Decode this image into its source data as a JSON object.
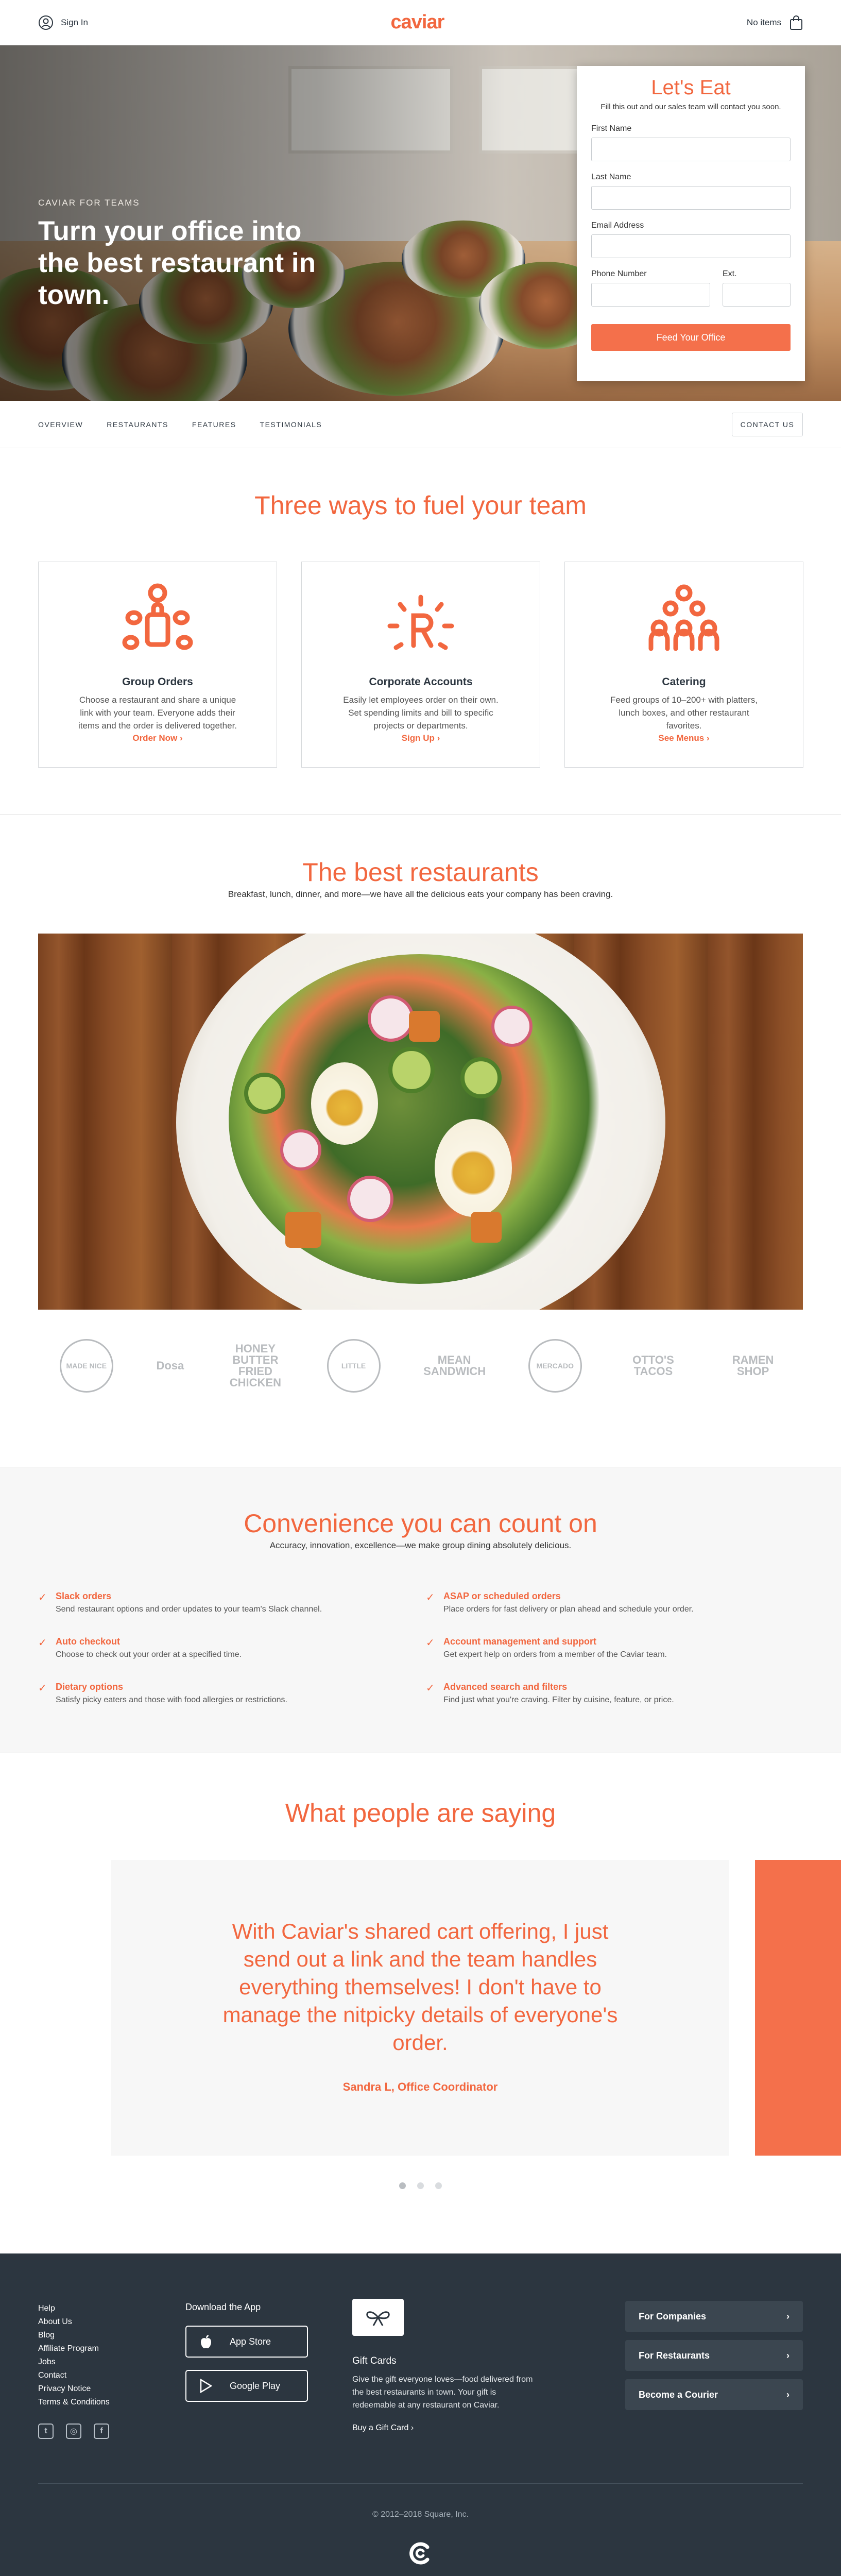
{
  "header": {
    "signin_label": "Sign In",
    "logo": "caviar",
    "cart_label": "No items"
  },
  "hero": {
    "tag": "CAVIAR FOR TEAMS",
    "title": "Turn your office into the best restaurant in town."
  },
  "form": {
    "title": "Let's Eat",
    "subtitle": "Fill this out and our sales team will contact you soon.",
    "first_name_label": "First Name",
    "last_name_label": "Last Name",
    "email_label": "Email Address",
    "phone_label": "Phone Number",
    "ext_label": "Ext.",
    "submit_label": "Feed Your Office"
  },
  "subnav": {
    "links": [
      "OVERVIEW",
      "RESTAURANTS",
      "FEATURES",
      "TESTIMONIALS"
    ],
    "contact_label": "CONTACT US"
  },
  "three_ways": {
    "title": "Three ways to fuel your team",
    "cards": [
      {
        "title": "Group Orders",
        "desc": "Choose a restaurant and share a unique link with your team. Everyone adds their items and the order is delivered together.",
        "cta": "Order Now ›"
      },
      {
        "title": "Corporate Accounts",
        "desc": "Easily let employees order on their own. Set spending limits and bill to specific projects or departments.",
        "cta": "Sign Up ›"
      },
      {
        "title": "Catering",
        "desc": "Feed groups of 10–200+ with platters, lunch boxes, and other restaurant favorites.",
        "cta": "See Menus ›"
      }
    ]
  },
  "best": {
    "title": "The best restaurants",
    "subtitle": "Breakfast, lunch, dinner, and more—we have all the delicious eats your company has been craving.",
    "logos": [
      "MADE NICE",
      "Dosa",
      "HONEY BUTTER FRIED CHICKEN",
      "LITTLE",
      "MEAN SANDWICH",
      "MERCADO",
      "OTTO'S TACOS",
      "RAMEN SHOP"
    ]
  },
  "convenience": {
    "title": "Convenience you can count on",
    "subtitle": "Accuracy, innovation, excellence—we make group dining absolutely delicious.",
    "features": [
      {
        "title": "Slack orders",
        "desc": "Send restaurant options and order updates to your team's Slack channel."
      },
      {
        "title": "ASAP or scheduled orders",
        "desc": "Place orders for fast delivery or plan ahead and schedule your order."
      },
      {
        "title": "Auto checkout",
        "desc": "Choose to check out your order at a specified time."
      },
      {
        "title": "Account management and support",
        "desc": "Get expert help on orders from a member of the Caviar team."
      },
      {
        "title": "Dietary options",
        "desc": "Satisfy picky eaters and those with food allergies or restrictions."
      },
      {
        "title": "Advanced search and filters",
        "desc": "Find just what you're craving. Filter by cuisine, feature, or price."
      }
    ],
    "check": "✓"
  },
  "testimonials": {
    "title": "What people are saying",
    "quote": "With Caviar's shared cart offering, I just send out a link and the team handles everything themselves! I don't have to manage the nitpicky details of everyone's order.",
    "author": "Sandra L, Office Coordinator"
  },
  "footer": {
    "links": [
      "Help",
      "About Us",
      "Blog",
      "Affiliate Program",
      "Jobs",
      "Contact",
      "Privacy Notice",
      "Terms & Conditions"
    ],
    "download_title": "Download the App",
    "app_store": "App Store",
    "google_play": "Google Play",
    "gift_title": "Gift Cards",
    "gift_desc": "Give the gift everyone loves—food delivered from the best restaurants in town. Your gift is redeemable at any restaurant on Caviar.",
    "gift_link": "Buy a Gift Card ›",
    "buttons": [
      "For Companies",
      "For Restaurants",
      "Become a Courier"
    ],
    "chevron": "›",
    "copyright": "© 2012–2018 Square, Inc."
  },
  "colors": {
    "brand": "#f2673f",
    "footer_bg": "#2c3640"
  }
}
